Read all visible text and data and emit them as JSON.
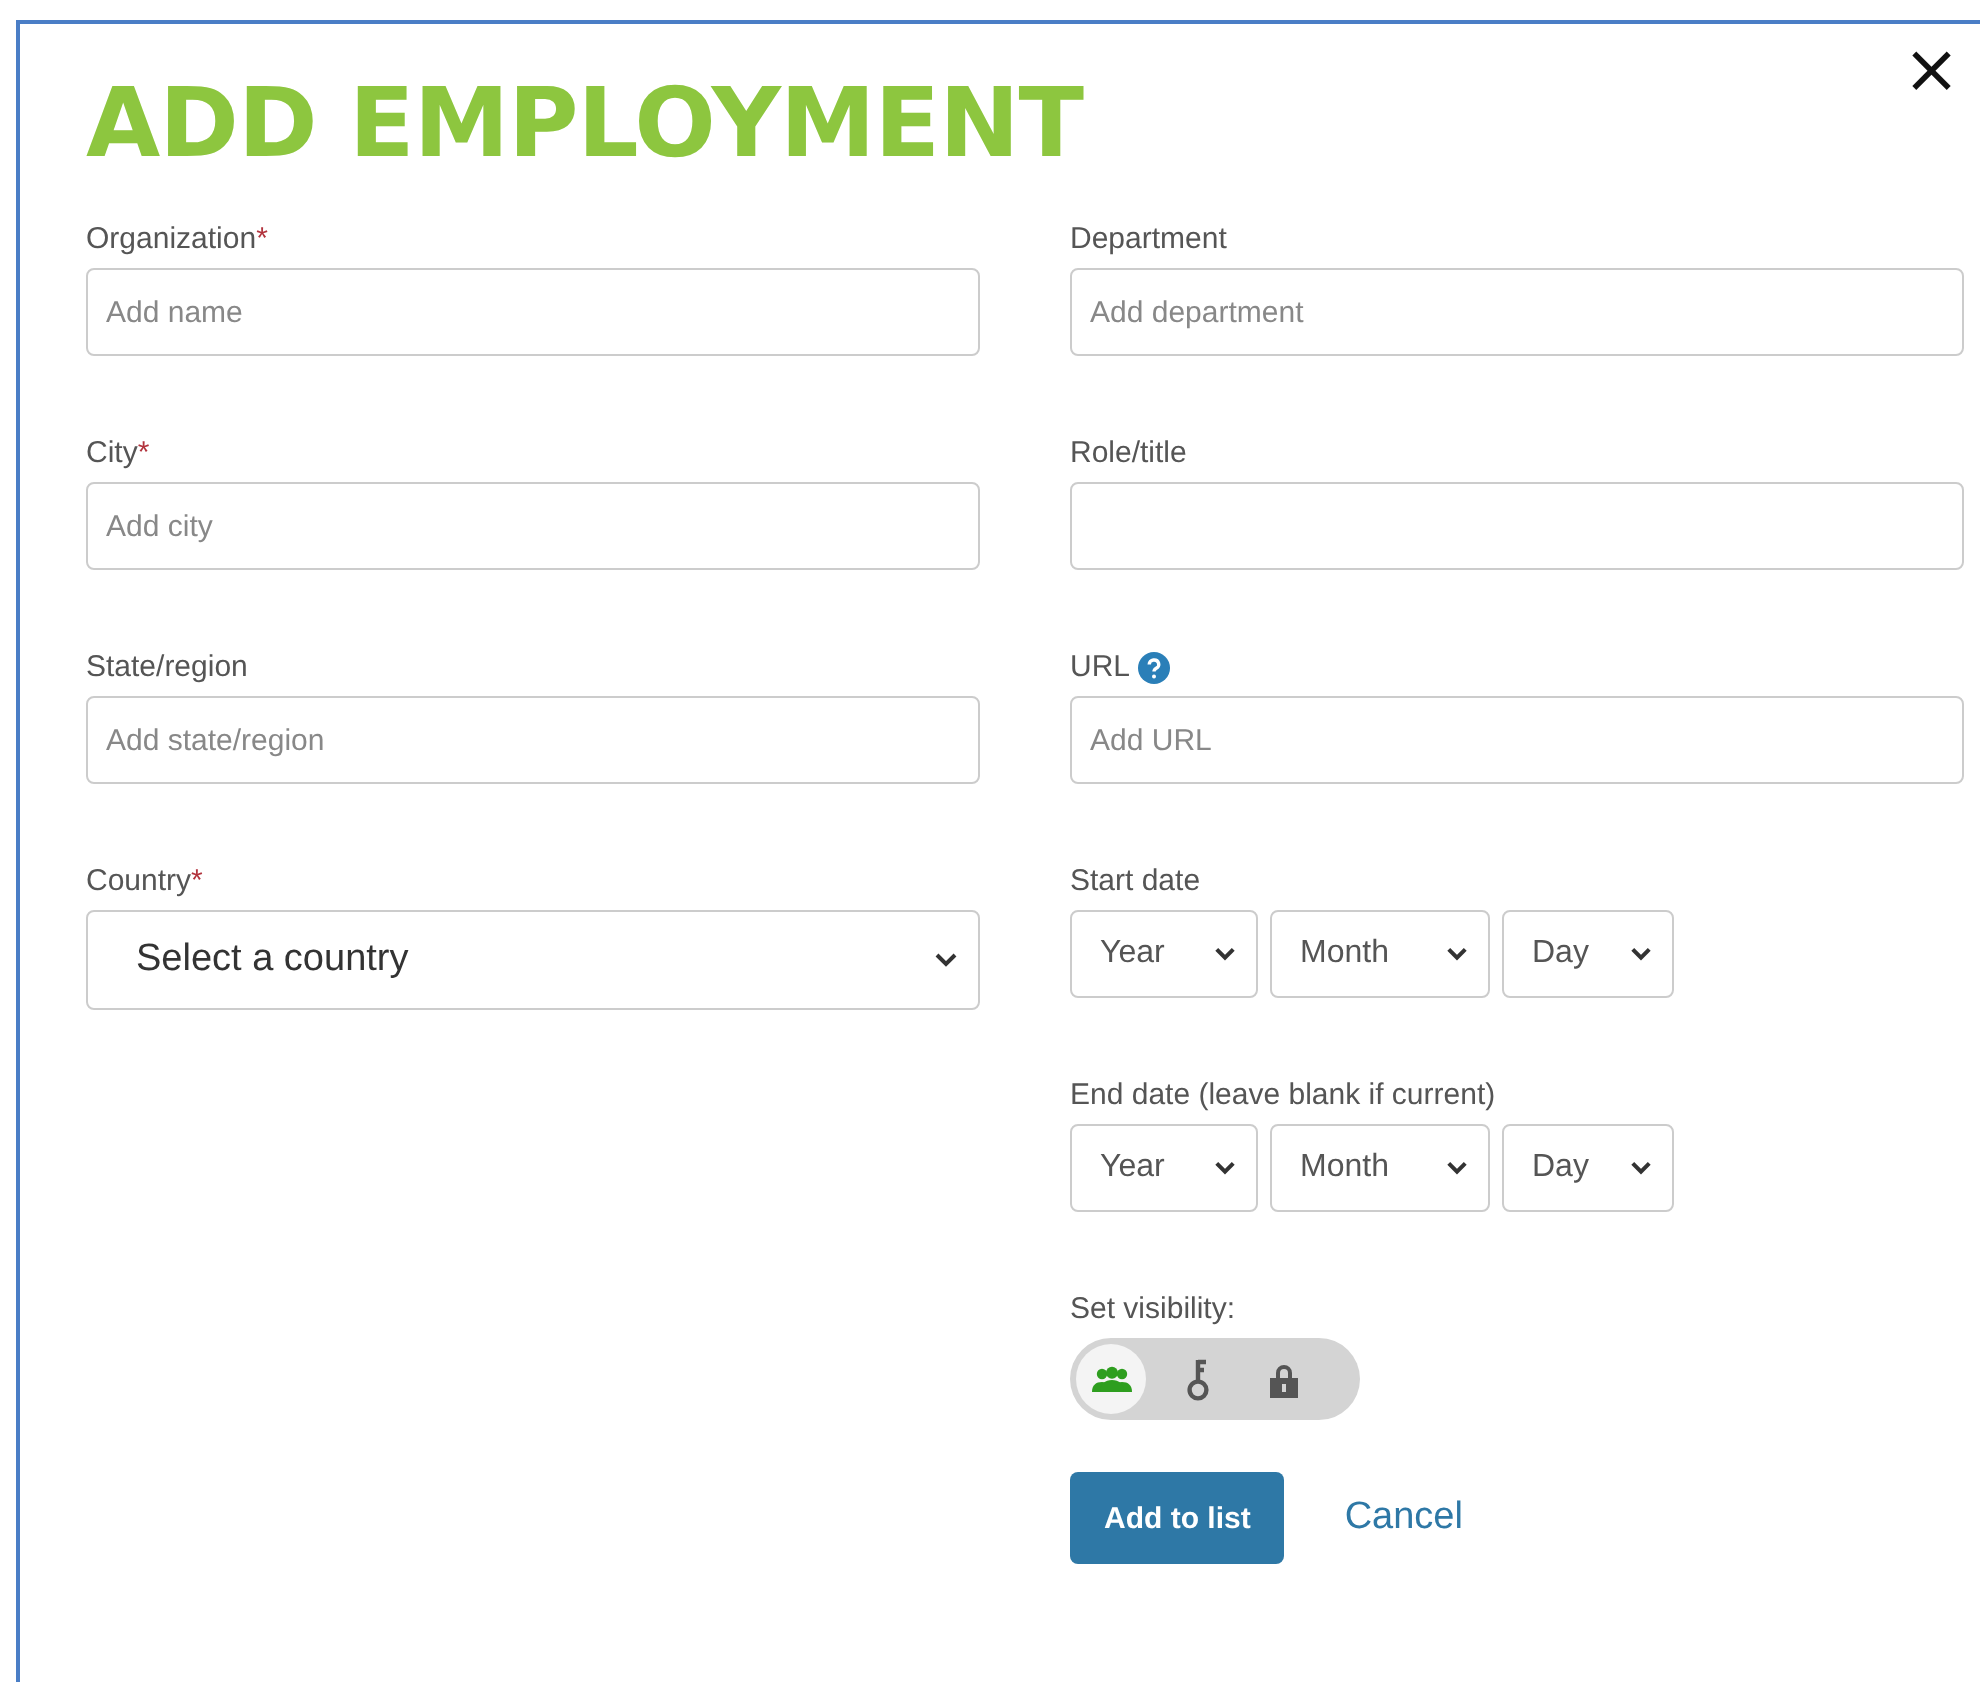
{
  "dialog": {
    "title": "ADD EMPLOYMENT",
    "close": "×"
  },
  "left_fields": [
    {
      "kind": "text",
      "label": "Organization",
      "required_mark": "*",
      "placeholder": "Add name"
    },
    {
      "kind": "text",
      "label": "City",
      "required_mark": "*",
      "placeholder": "Add city"
    },
    {
      "kind": "text",
      "label": "State/region",
      "placeholder": "Add state/region"
    },
    {
      "kind": "select",
      "label": "Country",
      "required_mark": "*",
      "value": "Select a country"
    }
  ],
  "right_fields": [
    {
      "kind": "text",
      "label": "Department",
      "placeholder": "Add department"
    },
    {
      "kind": "text",
      "label": "Role/title"
    },
    {
      "kind": "text",
      "label": "URL",
      "help": true,
      "placeholder": "Add URL"
    },
    {
      "kind": "date",
      "label": "Start date",
      "parts": [
        "Year",
        "Month",
        "Day"
      ]
    },
    {
      "kind": "date",
      "label": "End date (leave blank if current)",
      "parts": [
        "Year",
        "Month",
        "Day"
      ]
    }
  ],
  "visibility": {
    "label": "Set visibility:",
    "options": [
      {
        "kind": "everyone",
        "selected": true
      },
      {
        "kind": "trusted",
        "selected": false
      },
      {
        "kind": "private",
        "selected": false
      }
    ]
  },
  "buttons": {
    "primary": "Add to list",
    "secondary": "Cancel"
  }
}
